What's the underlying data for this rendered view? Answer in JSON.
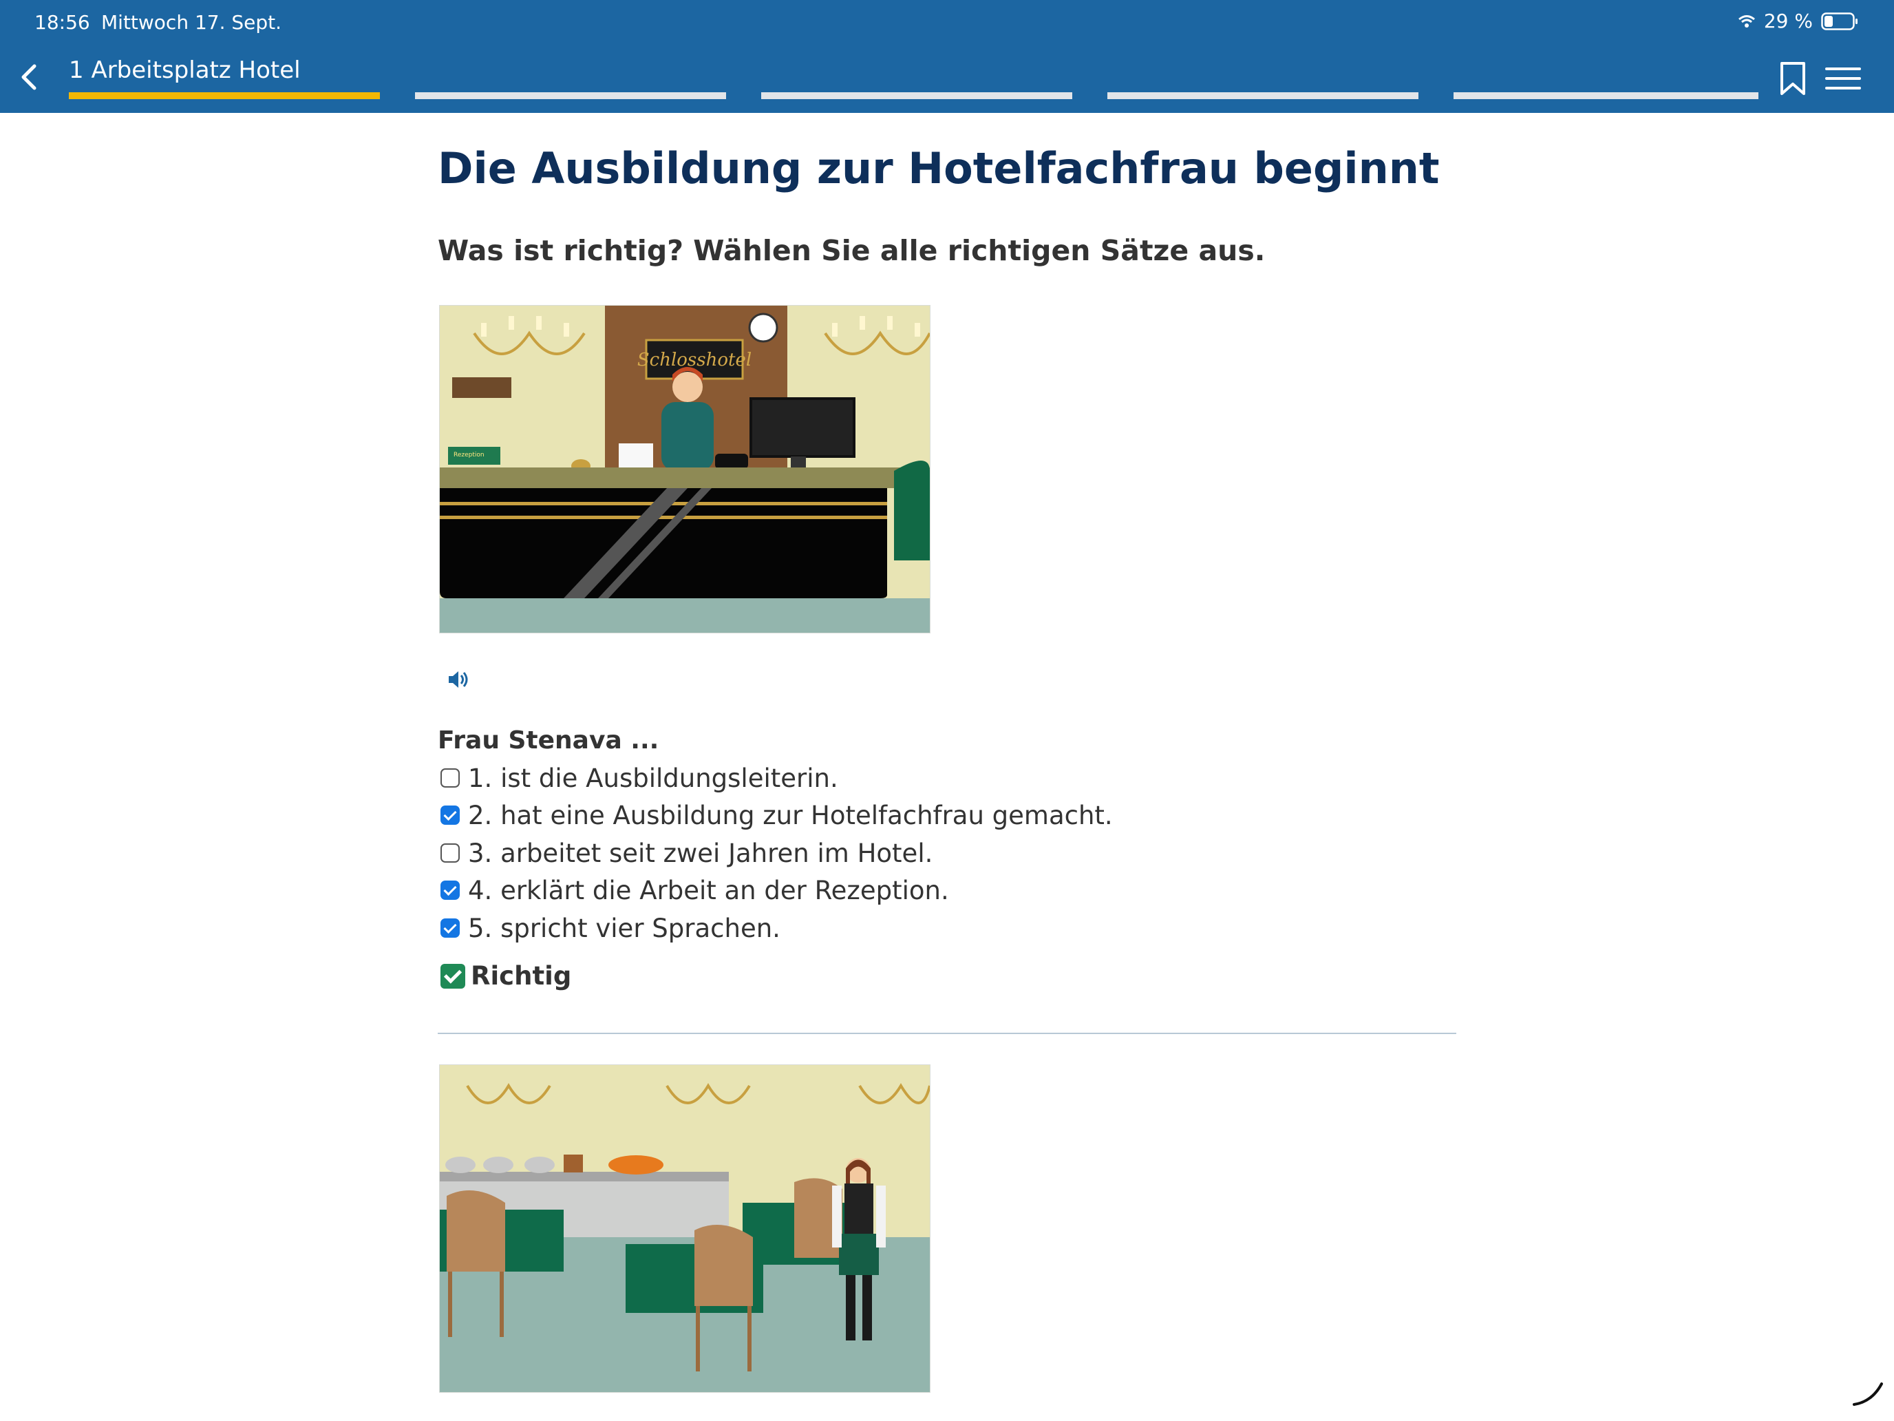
{
  "status_bar": {
    "time": "18:56",
    "date": "Mittwoch 17. Sept.",
    "battery": "29 %"
  },
  "header": {
    "chapter_title": "1 Arbeitsplatz Hotel",
    "progress_segments": 5,
    "active_segment": 1
  },
  "main": {
    "title": "Die Ausbildung zur Hotelfachfrau beginnt",
    "instruction": "Was ist richtig? Wählen Sie alle richtigen Sätze aus.",
    "scene1": {
      "sign": "Schlosshotel",
      "desk_label": "Rezeption"
    },
    "question_lead": "Frau Stenava ...",
    "options": [
      {
        "label": "1. ist die Ausbildungsleiterin.",
        "checked": false
      },
      {
        "label": "2. hat eine Ausbildung zur Hotelfachfrau gemacht.",
        "checked": true
      },
      {
        "label": "3. arbeitet seit zwei Jahren im Hotel.",
        "checked": false
      },
      {
        "label": "4. erklärt die Arbeit an der Rezeption.",
        "checked": true
      },
      {
        "label": "5. spricht vier Sprachen.",
        "checked": true
      }
    ],
    "feedback": "Richtig"
  },
  "colors": {
    "header": "#1c66a2",
    "progress_active": "#f2b705",
    "title": "#0e2f5a",
    "checkbox_on": "#1476e3",
    "correct": "#1f8a56"
  },
  "icons": [
    "back-icon",
    "bookmark-icon",
    "menu-icon",
    "wifi-icon",
    "battery-icon",
    "speaker-icon"
  ]
}
